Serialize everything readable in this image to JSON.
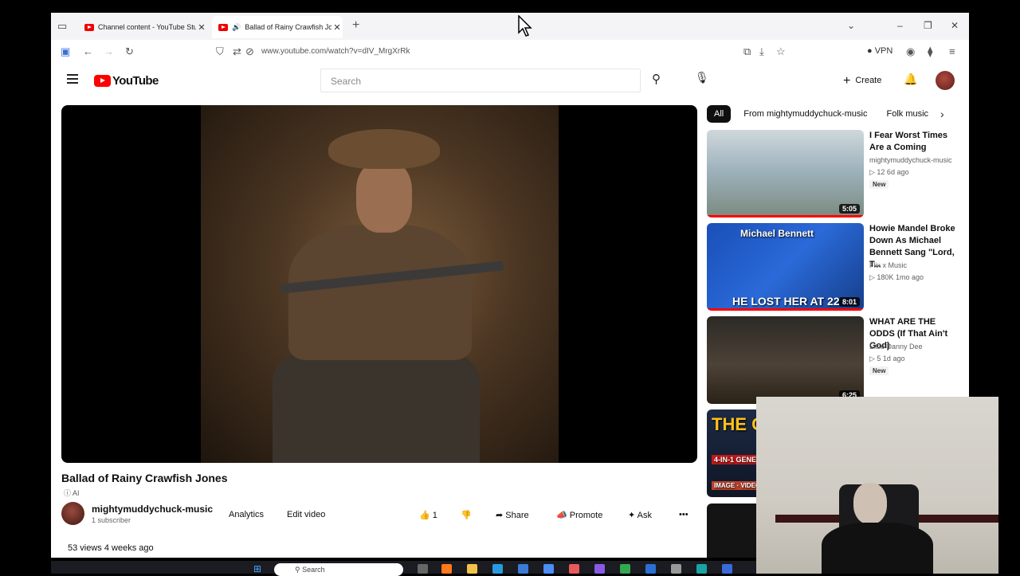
{
  "tabs": [
    {
      "label": "Channel content - YouTube Stu",
      "active": false
    },
    {
      "label": "Ballad of Rainy Crawfish Jo",
      "active": true
    }
  ],
  "address": {
    "url": "www.youtube.com/watch?v=dIV_MrgXrRk",
    "vpn_label": "VPN"
  },
  "youtube": {
    "logo_text": "YouTube",
    "search_placeholder": "Search",
    "create_label": "Create"
  },
  "video": {
    "title": "Ballad of Rainy Crawfish Jones",
    "ai_label": "AI",
    "channel_name": "mightymuddychuck-music",
    "subscribers": "1 subscriber",
    "analytics_label": "Analytics",
    "edit_label": "Edit video",
    "likes": "1",
    "share_label": "Share",
    "promote_label": "Promote",
    "ask_label": "Ask",
    "views_line": "53 views  4 weeks ago"
  },
  "chips": [
    "All",
    "From mightymuddychuck-music",
    "Folk music"
  ],
  "recommendations": [
    {
      "title": "I Fear Worst Times Are a Coming",
      "channel": "mightymuddychuck-music",
      "meta": "12  6d ago",
      "badge": "New",
      "duration": "5:05",
      "progress": 1.0
    },
    {
      "title": "Howie Mandel Broke Down As Michael Bennett Sang \"Lord, T...",
      "channel": "Flix x Music",
      "meta": "180K  1mo ago",
      "badge": "",
      "duration": "8:01",
      "thumb_text_top": "Michael Bennett",
      "thumb_text_bottom": "HE LOST HER AT 22",
      "progress": 1.0
    },
    {
      "title": "WHAT ARE THE ODDS (If That Ain't God)",
      "channel": "Little Danny Dee",
      "meta": "5  1d ago",
      "badge": "New",
      "duration": "6:25",
      "progress": 0
    },
    {
      "title": "",
      "channel": "",
      "meta": "",
      "badge": "",
      "duration": "",
      "thumb_text_top": "THE GOD",
      "thumb_text_mid": "4-IN-1 GENE",
      "thumb_text_bottom": "IMAGE · VIDEO ·",
      "progress": 0
    }
  ],
  "taskbar": {
    "search_label": "Search"
  }
}
